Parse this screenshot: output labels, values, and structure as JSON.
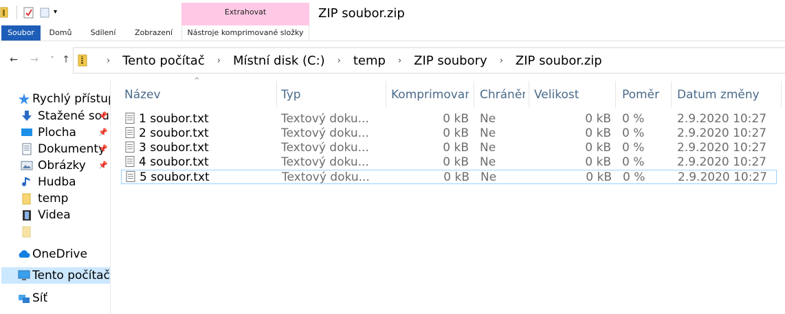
{
  "window": {
    "title": "ZIP soubor.zip",
    "context_group": "Extrahovat"
  },
  "ribbon": {
    "tabs": [
      {
        "label": "Soubor",
        "active": true
      },
      {
        "label": "Domů"
      },
      {
        "label": "Sdílení"
      },
      {
        "label": "Zobrazení"
      },
      {
        "label": "Nástroje komprimované složky"
      }
    ]
  },
  "quick_access": {
    "icons": [
      "folder-icon",
      "properties-icon",
      "new-folder-icon",
      "customize-dropdown-icon"
    ]
  },
  "nav": {
    "back": "←",
    "forward": "→",
    "recent": "˅",
    "up": "↑"
  },
  "address": {
    "icon": "zip-folder-icon",
    "separator": "›",
    "crumbs": [
      "Tento počítač",
      "Místní disk (C:)",
      "temp",
      "ZIP soubory",
      "ZIP soubor.zip"
    ]
  },
  "sidebar": {
    "items": [
      {
        "label": "Rychlý přístup",
        "icon": "star-icon",
        "pinned": false
      },
      {
        "label": "Stažené soubory",
        "icon": "download-icon",
        "pinned": true
      },
      {
        "label": "Plocha",
        "icon": "desktop-icon",
        "pinned": true
      },
      {
        "label": "Dokumenty",
        "icon": "documents-icon",
        "pinned": true
      },
      {
        "label": "Obrázky",
        "icon": "pictures-icon",
        "pinned": true
      },
      {
        "label": "Hudba",
        "icon": "music-icon",
        "pinned": false
      },
      {
        "label": "temp",
        "icon": "folder-icon",
        "pinned": false
      },
      {
        "label": "Videa",
        "icon": "video-icon",
        "pinned": false
      },
      {
        "label": "",
        "icon": "folder-icon",
        "pinned": false
      },
      {
        "label": "OneDrive",
        "icon": "cloud-icon",
        "pinned": false
      },
      {
        "label": "Tento počítač",
        "icon": "computer-icon",
        "pinned": false,
        "selected": true
      },
      {
        "label": "Síť",
        "icon": "network-icon",
        "pinned": false
      }
    ]
  },
  "columns": [
    "Název",
    "Typ",
    "Komprimovaná velikost",
    "Chráněno heslem",
    "Velikost",
    "Poměr",
    "Datum změny"
  ],
  "files": [
    {
      "name": "1 soubor.txt",
      "type": "Textový doku...",
      "compressed": "0 kB",
      "protected": "Ne",
      "size": "0 kB",
      "ratio": "0 %",
      "date": "2.9.2020 10:27"
    },
    {
      "name": "2 soubor.txt",
      "type": "Textový doku...",
      "compressed": "0 kB",
      "protected": "Ne",
      "size": "0 kB",
      "ratio": "0 %",
      "date": "2.9.2020 10:27"
    },
    {
      "name": "3 soubor.txt",
      "type": "Textový doku...",
      "compressed": "0 kB",
      "protected": "Ne",
      "size": "0 kB",
      "ratio": "0 %",
      "date": "2.9.2020 10:27"
    },
    {
      "name": "4 soubor.txt",
      "type": "Textový doku...",
      "compressed": "0 kB",
      "protected": "Ne",
      "size": "0 kB",
      "ratio": "0 %",
      "date": "2.9.2020 10:27"
    },
    {
      "name": "5 soubor.txt",
      "type": "Textový doku...",
      "compressed": "0 kB",
      "protected": "Ne",
      "size": "0 kB",
      "ratio": "0 %",
      "date": "2.9.2020 10:27",
      "focused": true
    }
  ],
  "colors": {
    "accent": "#1e5eb8",
    "context_tab": "#ffc8e4",
    "selection": "#cce8ff",
    "header_text": "#4a6a8a"
  }
}
